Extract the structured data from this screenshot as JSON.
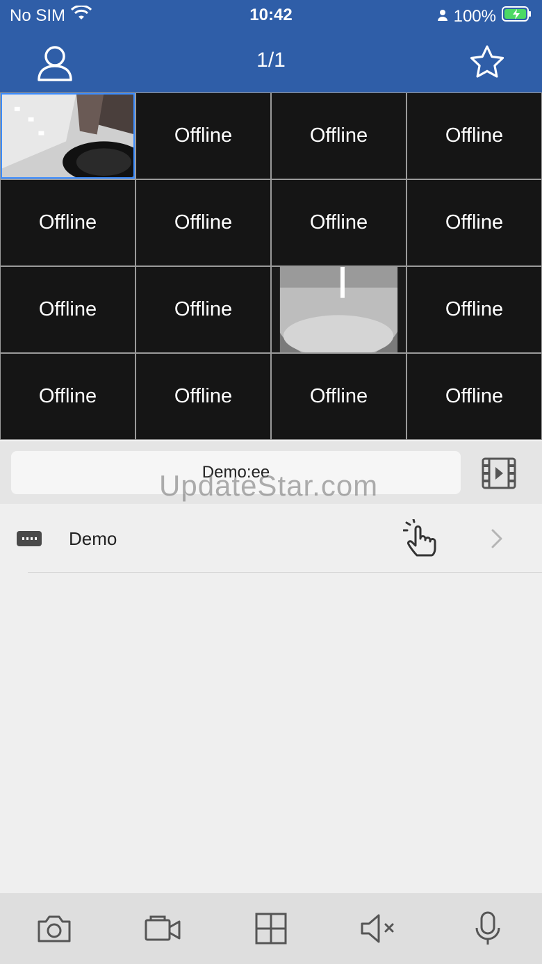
{
  "status_bar": {
    "carrier": "No SIM",
    "time": "10:42",
    "battery": "100%"
  },
  "header": {
    "title": "1/1"
  },
  "grid": {
    "cells": [
      {
        "label": ""
      },
      {
        "label": "Offline"
      },
      {
        "label": "Offline"
      },
      {
        "label": "Offline"
      },
      {
        "label": "Offline"
      },
      {
        "label": "Offline"
      },
      {
        "label": "Offline"
      },
      {
        "label": "Offline"
      },
      {
        "label": "Offline"
      },
      {
        "label": "Offline"
      },
      {
        "label": ""
      },
      {
        "label": "Offline"
      },
      {
        "label": "Offline"
      },
      {
        "label": "Offline"
      },
      {
        "label": "Offline"
      },
      {
        "label": "Offline"
      }
    ]
  },
  "device_bar": {
    "name": "Demo:ee"
  },
  "watermark": "UpdateStar.com",
  "device_list": {
    "items": [
      {
        "label": "Demo"
      }
    ]
  },
  "toolbar": {
    "icons": [
      "camera-icon",
      "record-icon",
      "grid-layout-icon",
      "mute-icon",
      "microphone-icon"
    ]
  },
  "colors": {
    "header": "#2f5ea8",
    "cell": "#151515",
    "accent_select": "#3c8cff"
  }
}
